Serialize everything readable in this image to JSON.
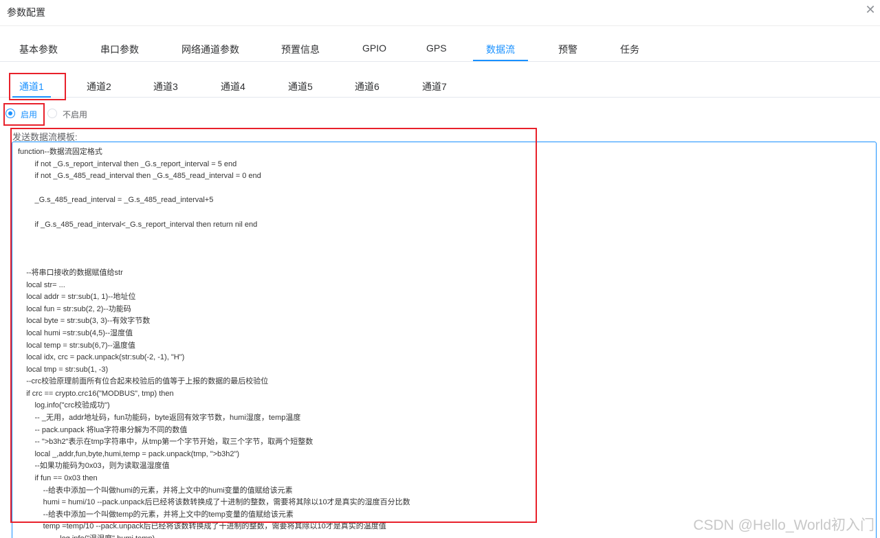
{
  "dialog": {
    "title": "参数配置",
    "close_icon": "close-icon"
  },
  "main_tabs": [
    {
      "label": "基本参数"
    },
    {
      "label": "串口参数"
    },
    {
      "label": "网络通道参数"
    },
    {
      "label": "预置信息"
    },
    {
      "label": "GPIO"
    },
    {
      "label": "GPS"
    },
    {
      "label": "数据流",
      "active": true
    },
    {
      "label": "预警"
    },
    {
      "label": "任务"
    }
  ],
  "channel_tabs": [
    {
      "label": "通道1",
      "active": true
    },
    {
      "label": "通道2"
    },
    {
      "label": "通道3"
    },
    {
      "label": "通道4"
    },
    {
      "label": "通道5"
    },
    {
      "label": "通道6"
    },
    {
      "label": "通道7"
    }
  ],
  "enable_options": [
    {
      "label": "启用",
      "selected": true
    },
    {
      "label": "不启用",
      "selected": false
    }
  ],
  "template_label": "发送数据流模板:",
  "code_lines": [
    "function--数据流固定格式",
    "        if not _G.s_report_interval then _G.s_report_interval = 5 end",
    "        if not _G.s_485_read_interval then _G.s_485_read_interval = 0 end",
    "",
    "        _G.s_485_read_interval = _G.s_485_read_interval+5",
    "",
    "        if _G.s_485_read_interval<_G.s_report_interval then return nil end",
    "",
    "",
    "",
    "    --将串口接收的数据赋值给str",
    "    local str= ...",
    "    local addr = str:sub(1, 1)--地址位",
    "    local fun = str:sub(2, 2)--功能码",
    "    local byte = str:sub(3, 3)--有效字节数",
    "    local humi =str:sub(4,5)--湿度值",
    "    local temp = str:sub(6,7)--温度值",
    "    local idx, crc = pack.unpack(str:sub(-2, -1), \"H\")",
    "    local tmp = str:sub(1, -3)",
    "    --crc校验原理前面所有位合起来校验后的值等于上报的数据的最后校验位",
    "    if crc == crypto.crc16(\"MODBUS\", tmp) then",
    "        log.info(\"crc校验成功\")",
    "        -- _无用，addr地址码，fun功能码，byte返回有效字节数，humi湿度，temp温度",
    "        -- pack.unpack 将lua字符串分解为不同的数值",
    "        -- \">b3h2\"表示在tmp字符串中，从tmp第一个字节开始，取三个字节，取两个短整数",
    "        local _,addr,fun,byte,humi,temp = pack.unpack(tmp, \">b3h2\")",
    "        --如果功能码为0x03，则为读取温湿度值",
    "        if fun == 0x03 then",
    "            --给表中添加一个叫做humi的元素，并将上文中的humi变量的值赋给该元素",
    "            humi = humi/10 --pack.unpack后已经将该数转换成了十进制的整数，需要将其除以10才是真实的湿度百分比数",
    "            --给表中添加一个叫做temp的元素，并将上文中的temp变量的值赋给该元素",
    "            temp =temp/10 --pack.unpack后已经将该数转换成了十进制的整数，需要将其除以10才是真实的温度值",
    "                    log.info(\"温湿度\",humi,temp)"
  ],
  "watermark": "CSDN @Hello_World初入门"
}
